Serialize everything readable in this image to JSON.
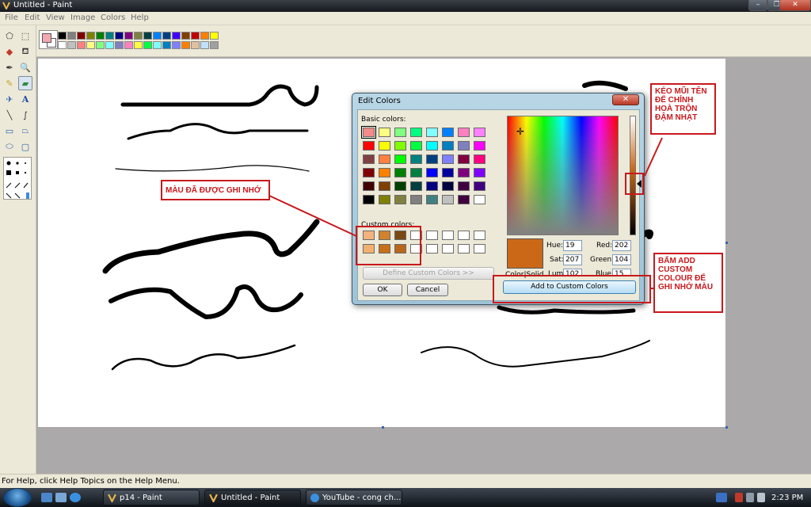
{
  "window": {
    "title": "Untitled - Paint",
    "minimize": "–",
    "maximize": "❐",
    "close": "✕"
  },
  "menu": [
    "File",
    "Edit",
    "View",
    "Image",
    "Colors",
    "Help"
  ],
  "palette": {
    "row1": [
      "#000000",
      "#808080",
      "#800000",
      "#808000",
      "#008000",
      "#008080",
      "#000080",
      "#800080",
      "#808040",
      "#004040",
      "#0080ff",
      "#004080",
      "#4000ff",
      "#804000",
      "#c00000",
      "#ff8000",
      "#ffff00",
      "#80ff00",
      "#00ff80",
      "#00c0ff",
      "#8080ff",
      "#ff00ff",
      "#ff8040",
      "#c0c0ff"
    ],
    "row2": [
      "#ffffff",
      "#c0c0c0",
      "#ff8080",
      "#ffff80",
      "#80ff80",
      "#80ffff",
      "#8080c0",
      "#ff80c0",
      "#ffff40",
      "#00ff40",
      "#80ffff",
      "#0080c0",
      "#8080ff",
      "#ff8000",
      "#e0c0a0",
      "#c0e0ff",
      "#a0a0a0",
      "#b0c0d0"
    ]
  },
  "dialog": {
    "title": "Edit Colors",
    "close": "✕",
    "basic_label": "Basic colors:",
    "custom_label": "Custom colors:",
    "basic_colors": [
      "#f48a8a",
      "#ffff80",
      "#80ff80",
      "#00ff80",
      "#80ffff",
      "#0080ff",
      "#ff80c0",
      "#ff80ff",
      "#ff0000",
      "#ffff00",
      "#80ff00",
      "#00ff40",
      "#00ffff",
      "#0080c0",
      "#8080c0",
      "#ff00ff",
      "#804040",
      "#ff8040",
      "#00ff00",
      "#008080",
      "#004080",
      "#8080ff",
      "#800040",
      "#ff0080",
      "#800000",
      "#ff8000",
      "#008000",
      "#008040",
      "#0000ff",
      "#0000a0",
      "#800080",
      "#8000ff",
      "#400000",
      "#804000",
      "#004000",
      "#004040",
      "#000080",
      "#000040",
      "#400040",
      "#400080",
      "#000000",
      "#808000",
      "#808040",
      "#808080",
      "#408080",
      "#c0c0c0",
      "#400040",
      "#ffffff"
    ],
    "custom_colors": [
      "#f2b27e",
      "#d2812c",
      "#7a4a14",
      "#ffffff",
      "#ffffff",
      "#ffffff",
      "#ffffff",
      "#ffffff",
      "#f2b070",
      "#c86f1a",
      "#b8661c",
      "#ffffff",
      "#ffffff",
      "#ffffff",
      "#ffffff",
      "#ffffff"
    ],
    "define_custom": "Define Custom Colors >>",
    "ok": "OK",
    "cancel": "Cancel",
    "color_solid": "Color|Solid",
    "hue_label": "Hue:",
    "hue": "19",
    "sat_label": "Sat:",
    "sat": "207",
    "lum_label": "Lum:",
    "lum": "102",
    "red_label": "Red:",
    "red": "202",
    "green_label": "Green:",
    "green": "104",
    "blue_label": "Blue:",
    "blue": "15",
    "add_custom": "Add to Custom Colors",
    "current_color": "#ca6817"
  },
  "callouts": {
    "remembered": "MÀU ĐÃ ĐƯỢC GHI NHỚ",
    "slider": "KÉO MŨI TÊN ĐỂ CHỈNH HOÀ TRỘN ĐẬM NHẠT",
    "add": "BẤM ADD CUSTOM COLOUR ĐỂ GHI NHỚ MÀU"
  },
  "status": "For Help, click Help Topics on the Help Menu.",
  "taskbar": {
    "tasks": [
      "p14 - Paint",
      "Untitled - Paint",
      "YouTube - cong ch..."
    ],
    "clock": "2:23 PM"
  }
}
